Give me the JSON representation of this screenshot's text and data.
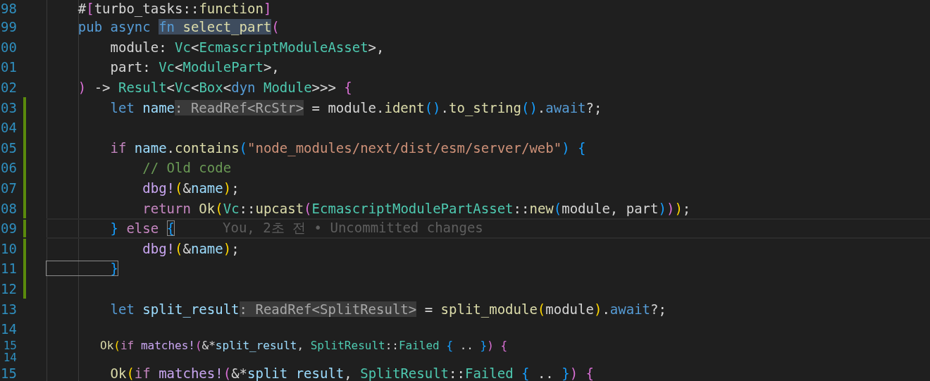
{
  "editor": {
    "lines": [
      {
        "number": "98",
        "changed": false,
        "current": false,
        "squeezed": false,
        "tokens": [
          {
            "text": "    #",
            "kind": "plain"
          },
          {
            "text": "[",
            "kind": "br2"
          },
          {
            "text": "turbo_tasks::",
            "kind": "plain"
          },
          {
            "text": "function",
            "kind": "fn"
          },
          {
            "text": "]",
            "kind": "br2"
          }
        ]
      },
      {
        "number": "99",
        "changed": false,
        "current": false,
        "squeezed": false,
        "tokens": [
          {
            "text": "    pub ",
            "kind": "kw"
          },
          {
            "text": "async ",
            "kind": "kw"
          },
          {
            "text": "fn ",
            "kind": "selected-keyword"
          },
          {
            "text": "select_part",
            "kind": "selected-function"
          },
          {
            "text": "(",
            "kind": "br2"
          }
        ]
      },
      {
        "number": "00",
        "changed": false,
        "current": false,
        "squeezed": false,
        "tokens": [
          {
            "text": "        module: ",
            "kind": "plain"
          },
          {
            "text": "Vc",
            "kind": "type"
          },
          {
            "text": "<",
            "kind": "plain"
          },
          {
            "text": "EcmascriptModuleAsset",
            "kind": "type"
          },
          {
            "text": ">,",
            "kind": "plain"
          }
        ]
      },
      {
        "number": "01",
        "changed": false,
        "current": false,
        "squeezed": false,
        "tokens": [
          {
            "text": "        part: ",
            "kind": "plain"
          },
          {
            "text": "Vc",
            "kind": "type"
          },
          {
            "text": "<",
            "kind": "plain"
          },
          {
            "text": "ModulePart",
            "kind": "type"
          },
          {
            "text": ">,",
            "kind": "plain"
          }
        ]
      },
      {
        "number": "02",
        "changed": false,
        "current": false,
        "squeezed": false,
        "tokens": [
          {
            "text": "    )",
            "kind": "br2"
          },
          {
            "text": " -> ",
            "kind": "plain"
          },
          {
            "text": "Result",
            "kind": "type"
          },
          {
            "text": "<",
            "kind": "plain"
          },
          {
            "text": "Vc",
            "kind": "type"
          },
          {
            "text": "<",
            "kind": "plain"
          },
          {
            "text": "Box",
            "kind": "type"
          },
          {
            "text": "<",
            "kind": "plain"
          },
          {
            "text": "dyn ",
            "kind": "kw"
          },
          {
            "text": "Module",
            "kind": "type"
          },
          {
            "text": ">>> ",
            "kind": "plain"
          },
          {
            "text": "{",
            "kind": "br2"
          }
        ]
      },
      {
        "number": "03",
        "changed": true,
        "current": false,
        "squeezed": false,
        "tokens": [
          {
            "text": "        let ",
            "kind": "kw"
          },
          {
            "text": "name",
            "kind": "var"
          },
          {
            "text": ": ReadRef<RcStr>",
            "kind": "inlay-hint"
          },
          {
            "text": " = module.",
            "kind": "plain"
          },
          {
            "text": "ident",
            "kind": "fn"
          },
          {
            "text": "()",
            "kind": "br3"
          },
          {
            "text": ".",
            "kind": "plain"
          },
          {
            "text": "to_string",
            "kind": "fn"
          },
          {
            "text": "()",
            "kind": "br3"
          },
          {
            "text": ".",
            "kind": "plain"
          },
          {
            "text": "await",
            "kind": "kw"
          },
          {
            "text": "?;",
            "kind": "plain"
          }
        ]
      },
      {
        "number": "04",
        "changed": true,
        "current": false,
        "squeezed": false
      },
      {
        "number": "05",
        "changed": true,
        "current": false,
        "squeezed": false,
        "tokens": [
          {
            "text": "        if ",
            "kind": "ctrl"
          },
          {
            "text": "name",
            "kind": "var"
          },
          {
            "text": ".",
            "kind": "plain"
          },
          {
            "text": "contains",
            "kind": "fn"
          },
          {
            "text": "(",
            "kind": "br3"
          },
          {
            "text": "\"node_modules/next/dist/esm/server/web\"",
            "kind": "str"
          },
          {
            "text": ")",
            "kind": "br3"
          },
          {
            "text": " {",
            "kind": "br3"
          }
        ]
      },
      {
        "number": "06",
        "changed": true,
        "current": false,
        "squeezed": false,
        "tokens": [
          {
            "text": "            // Old code",
            "kind": "comment"
          }
        ]
      },
      {
        "number": "07",
        "changed": true,
        "current": false,
        "squeezed": false,
        "tokens": [
          {
            "text": "            dbg!",
            "kind": "macro"
          },
          {
            "text": "(",
            "kind": "br1"
          },
          {
            "text": "&",
            "kind": "plain"
          },
          {
            "text": "name",
            "kind": "var"
          },
          {
            "text": ")",
            "kind": "br1"
          },
          {
            "text": ";",
            "kind": "plain"
          }
        ]
      },
      {
        "number": "08",
        "changed": true,
        "current": false,
        "squeezed": false,
        "tokens": [
          {
            "text": "            return ",
            "kind": "ctrl"
          },
          {
            "text": "Ok",
            "kind": "fn"
          },
          {
            "text": "(",
            "kind": "br1"
          },
          {
            "text": "Vc",
            "kind": "type"
          },
          {
            "text": "::",
            "kind": "plain"
          },
          {
            "text": "upcast",
            "kind": "fn"
          },
          {
            "text": "(",
            "kind": "br2"
          },
          {
            "text": "EcmascriptModulePartAsset",
            "kind": "type"
          },
          {
            "text": "::",
            "kind": "plain"
          },
          {
            "text": "new",
            "kind": "fn"
          },
          {
            "text": "(",
            "kind": "br3"
          },
          {
            "text": "module, part",
            "kind": "plain"
          },
          {
            "text": ")",
            "kind": "br3"
          },
          {
            "text": ")",
            "kind": "br2"
          },
          {
            "text": ")",
            "kind": "br1"
          },
          {
            "text": ";",
            "kind": "plain"
          }
        ]
      },
      {
        "number": "09",
        "changed": true,
        "current": true,
        "squeezed": false,
        "blame": "You, 2초 전 • Uncommitted changes",
        "tokens": [
          {
            "text": "        }",
            "kind": "br3"
          },
          {
            "text": " else ",
            "kind": "ctrl"
          },
          {
            "text": "{",
            "kind": "matched-bracket"
          }
        ]
      },
      {
        "number": "10",
        "changed": true,
        "current": false,
        "squeezed": false,
        "tokens": [
          {
            "text": "            dbg!",
            "kind": "macro"
          },
          {
            "text": "(",
            "kind": "br1"
          },
          {
            "text": "&",
            "kind": "plain"
          },
          {
            "text": "name",
            "kind": "var"
          },
          {
            "text": ")",
            "kind": "br1"
          },
          {
            "text": ";",
            "kind": "plain"
          }
        ]
      },
      {
        "number": "11",
        "changed": true,
        "current": false,
        "squeezed": false,
        "tokens": [
          {
            "text": "        }",
            "kind": "matched-bracket"
          }
        ]
      },
      {
        "number": "12",
        "changed": true,
        "current": false,
        "squeezed": false
      },
      {
        "number": "13",
        "changed": false,
        "current": false,
        "squeezed": false,
        "tokens": [
          {
            "text": "        let ",
            "kind": "kw"
          },
          {
            "text": "split_result",
            "kind": "var"
          },
          {
            "text": ": ReadRef<SplitResult>",
            "kind": "inlay-hint"
          },
          {
            "text": " = ",
            "kind": "plain"
          },
          {
            "text": "split_module",
            "kind": "fn"
          },
          {
            "text": "(",
            "kind": "br1"
          },
          {
            "text": "module",
            "kind": "plain"
          },
          {
            "text": ")",
            "kind": "br1"
          },
          {
            "text": ".",
            "kind": "plain"
          },
          {
            "text": "await",
            "kind": "kw"
          },
          {
            "text": "?;",
            "kind": "plain"
          }
        ]
      },
      {
        "number": "14",
        "changed": false,
        "current": false,
        "squeezed": false
      },
      {
        "number": "15",
        "changed": false,
        "current": false,
        "squeezed": true,
        "tokens": [
          {
            "text": "        Ok",
            "kind": "fn"
          },
          {
            "text": "(",
            "kind": "br1"
          },
          {
            "text": "if ",
            "kind": "ctrl"
          },
          {
            "text": "matches!",
            "kind": "macro"
          },
          {
            "text": "(",
            "kind": "br2"
          },
          {
            "text": "&*",
            "kind": "plain"
          },
          {
            "text": "split_result",
            "kind": "var"
          },
          {
            "text": ", ",
            "kind": "plain"
          },
          {
            "text": "SplitResult",
            "kind": "type"
          },
          {
            "text": "::",
            "kind": "plain"
          },
          {
            "text": "Failed ",
            "kind": "type"
          },
          {
            "text": "{",
            "kind": "br3"
          },
          {
            "text": " .. ",
            "kind": "plain"
          },
          {
            "text": "}",
            "kind": "br3"
          },
          {
            "text": ")",
            "kind": "br2"
          },
          {
            "text": " {",
            "kind": "br2"
          }
        ]
      },
      {
        "number": "14",
        "changed": false,
        "current": false,
        "squeezed": true
      },
      {
        "number": "15",
        "changed": false,
        "current": false,
        "squeezed": false,
        "tokens": [
          {
            "text": "        Ok",
            "kind": "fn"
          },
          {
            "text": "(",
            "kind": "br1"
          },
          {
            "text": "if ",
            "kind": "ctrl"
          },
          {
            "text": "matches!",
            "kind": "macro"
          },
          {
            "text": "(",
            "kind": "br2"
          },
          {
            "text": "&*",
            "kind": "plain"
          },
          {
            "text": "split_result",
            "kind": "var"
          },
          {
            "text": ", ",
            "kind": "plain"
          },
          {
            "text": "SplitResult",
            "kind": "type"
          },
          {
            "text": "::",
            "kind": "plain"
          },
          {
            "text": "Failed ",
            "kind": "type"
          },
          {
            "text": "{",
            "kind": "br3"
          },
          {
            "text": " .. ",
            "kind": "plain"
          },
          {
            "text": "}",
            "kind": "br3"
          },
          {
            "text": ")",
            "kind": "br2"
          },
          {
            "text": " {",
            "kind": "br2"
          }
        ]
      }
    ]
  }
}
